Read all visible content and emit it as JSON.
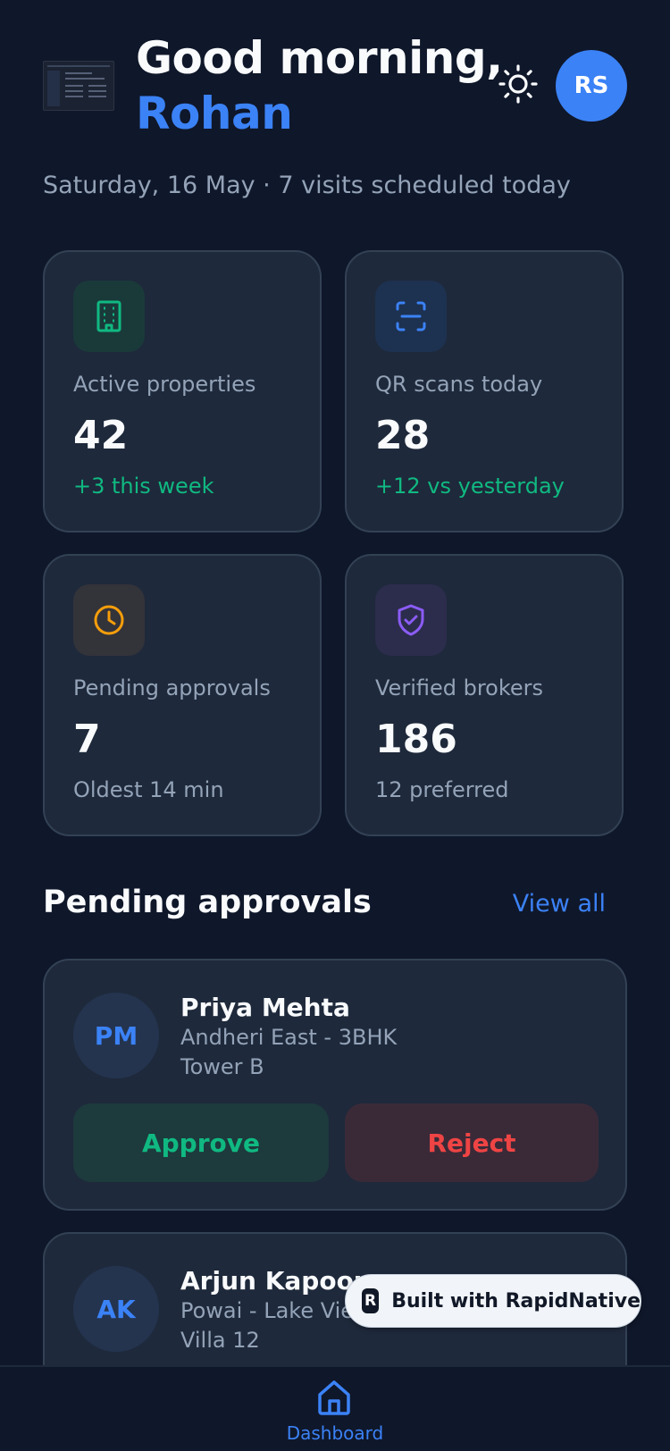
{
  "header": {
    "greeting": "Good morning,",
    "user_name": "Rohan",
    "avatar_initials": "RS",
    "theme_icon": "sun-icon"
  },
  "subline": "Saturday, 16 May · 7 visits scheduled today",
  "stats": [
    {
      "icon": "building-icon",
      "label": "Active properties",
      "value": "42",
      "note": "+3 this week",
      "accent": "#10b981",
      "icon_bg": "#1a3a3a"
    },
    {
      "icon": "qr-scan-icon",
      "label": "QR scans today",
      "value": "28",
      "note": "+12 vs yesterday",
      "accent": "#3b82f6",
      "icon_bg": "#1d3150"
    },
    {
      "icon": "clock-icon",
      "label": "Pending approvals",
      "value": "7",
      "note": "Oldest 14 min",
      "accent": "#f59e0b",
      "icon_bg": "#33333a"
    },
    {
      "icon": "shield-check-icon",
      "label": "Verified brokers",
      "value": "186",
      "note": "12 preferred",
      "accent": "#8b5cf6",
      "icon_bg": "#2c2c4c"
    }
  ],
  "pending": {
    "title": "Pending approvals",
    "view_all": "View all",
    "items": [
      {
        "initials": "PM",
        "name": "Priya Mehta",
        "location": "Andheri East - 3BHK",
        "unit": "Tower B",
        "approve": "Approve",
        "reject": "Reject"
      },
      {
        "initials": "AK",
        "name": "Arjun Kapoor",
        "location": "Powai - Lake View",
        "unit": "Villa 12"
      }
    ]
  },
  "badge": {
    "text": "Built with RapidNative",
    "logo": "R"
  },
  "nav": {
    "home_label": "Dashboard",
    "home_icon": "home-icon"
  },
  "colors": {
    "background": "#0f172a",
    "card": "#1e293b",
    "accent": "#3b82f6",
    "success": "#10b981",
    "danger": "#ef4444"
  }
}
